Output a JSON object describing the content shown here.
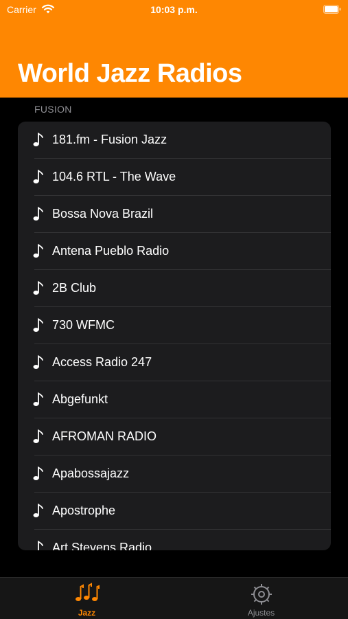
{
  "status_bar": {
    "carrier": "Carrier",
    "time": "10:03 p.m."
  },
  "header": {
    "title": "World Jazz Radios",
    "background_color": "#fe8702"
  },
  "section": {
    "title": "FUSION"
  },
  "stations": [
    {
      "name": "181.fm - Fusion Jazz",
      "icon": "music-note-icon"
    },
    {
      "name": "104.6 RTL - The Wave",
      "icon": "music-note-icon"
    },
    {
      "name": "Bossa Nova Brazil",
      "icon": "music-note-icon"
    },
    {
      "name": "Antena Pueblo Radio",
      "icon": "music-note-icon"
    },
    {
      "name": "2B Club",
      "icon": "music-note-icon"
    },
    {
      "name": "730 WFMC",
      "icon": "music-note-icon"
    },
    {
      "name": "Access Radio 247",
      "icon": "music-note-icon"
    },
    {
      "name": "Abgefunkt",
      "icon": "music-note-icon"
    },
    {
      "name": "AFROMAN RADIO",
      "icon": "music-note-icon"
    },
    {
      "name": "Apabossajazz",
      "icon": "music-note-icon"
    },
    {
      "name": "Apostrophe",
      "icon": "music-note-icon"
    },
    {
      "name": "Art Stevens Radio",
      "icon": "music-note-icon"
    }
  ],
  "tab_bar": {
    "tabs": [
      {
        "label": "Jazz",
        "icon": "music-notes-icon",
        "selected": true
      },
      {
        "label": "Ajustes",
        "icon": "gear-icon",
        "selected": false
      }
    ],
    "accent_color": "#fe8702",
    "inactive_color": "#8e8e93"
  }
}
